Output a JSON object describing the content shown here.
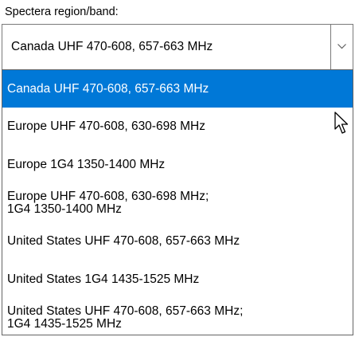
{
  "label": "Spectera region/band:",
  "combo": {
    "selected": "Canada UHF 470-608, 657-663 MHz",
    "button_icon": "chevron-down-icon"
  },
  "options": [
    {
      "lines": [
        "Canada UHF 470-608, 657-663 MHz"
      ],
      "highlighted": true
    },
    {
      "lines": [
        "Europe UHF 470-608, 630-698 MHz"
      ],
      "highlighted": false
    },
    {
      "lines": [
        "Europe 1G4 1350-1400 MHz"
      ],
      "highlighted": false
    },
    {
      "lines": [
        "Europe UHF 470-608, 630-698 MHz;",
        "1G4 1350-1400 MHz"
      ],
      "highlighted": false
    },
    {
      "lines": [
        "United States UHF 470-608, 657-663 MHz"
      ],
      "highlighted": false
    },
    {
      "lines": [
        "United States 1G4 1435-1525 MHz"
      ],
      "highlighted": false
    },
    {
      "lines": [
        "United States UHF 470-608, 657-663 MHz;",
        "1G4 1435-1525 MHz"
      ],
      "highlighted": false
    }
  ],
  "colors": {
    "highlight": "#0078d7",
    "highlight_text": "#ffffff",
    "border": "#7a7a7a"
  },
  "cursor_icon": "mouse-pointer-icon"
}
